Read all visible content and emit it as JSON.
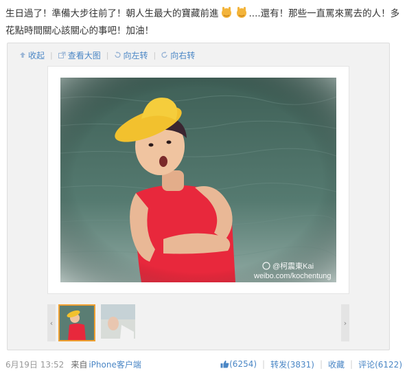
{
  "post": {
    "text_part1": "生日過了！準備大步往前了！朝人生最大的寶藏前進",
    "emoji_name": "rock-hand-emoji",
    "text_part2": "....還有！那些一直罵來罵去的人！多花點時間關心該關心的事吧！加油！"
  },
  "toolbar": {
    "collapse_label": "收起",
    "view_large_label": "查看大图",
    "rotate_left_label": "向左转",
    "rotate_right_label": "向右转"
  },
  "photo": {
    "watermark_name": "@柯震東Kai",
    "watermark_url": "weibo.com/kochentung"
  },
  "thumbnails": {
    "prev_glyph": "‹",
    "next_glyph": "›",
    "count": 2,
    "active_index": 0
  },
  "footer": {
    "timestamp": "6月19日 13:52",
    "source_prefix": "来自",
    "source_app": "iPhone客户端",
    "like_label": "(6254)",
    "repost_label": "转发(3831)",
    "favorite_label": "收藏",
    "comment_label": "评论(6122)"
  },
  "colors": {
    "link": "#4a86c5",
    "thumb_active_border": "#f0a030",
    "shirt_red": "#e8283c",
    "hat_yellow": "#f2c12e",
    "water": "#4d6e64"
  }
}
